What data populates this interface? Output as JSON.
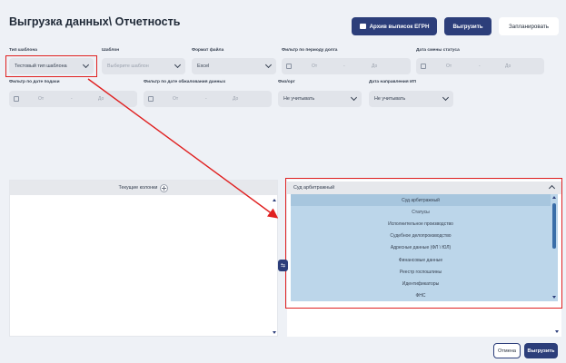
{
  "page": {
    "title": "Выгрузка данных\\ Отчетность"
  },
  "header_buttons": {
    "archive": "Архив выписок ЕГРН",
    "export": "Выгрузить",
    "schedule": "Запланировать"
  },
  "filters": {
    "template_type": {
      "label": "Тип шаблона",
      "value": "Тестовый тип шаблона"
    },
    "template": {
      "label": "Шаблон",
      "placeholder": "Выберите шаблон"
    },
    "file_format": {
      "label": "Формат файла",
      "value": "Excel"
    },
    "debt_period": {
      "label": "Фильтр по периоду долга",
      "from": "От",
      "dash": "-",
      "to": "До"
    },
    "status_change_date": {
      "label": "Дата смены статуса",
      "from": "От",
      "dash": "-",
      "to": "До"
    },
    "filing_date": {
      "label": "Фильтр по дате подачи",
      "from": "От",
      "dash": "-",
      "to": "До"
    },
    "appeal_date": {
      "label": "Фильтр по дате обжалования данных",
      "from": "От",
      "dash": "-",
      "to": "До"
    },
    "person_type": {
      "label": "Физ/орг",
      "value": "Не учитывать"
    },
    "ip_direction_date": {
      "label": "Дата направления ИП",
      "value": "Не учитывать"
    }
  },
  "columns_panel": {
    "header": "Текущие колонки"
  },
  "dropdown": {
    "header": "Суд арбитражный",
    "items": [
      "Суд арбитражный",
      "Статусы",
      "Исполнительное производство",
      "Судебное делопроизводство",
      "Адресные данные (ФЛ \\ ЮЛ)",
      "Финансовые данные",
      "Реестр госпошлины",
      "Идентификаторы",
      "ФНС"
    ],
    "selected_index": 0
  },
  "footer": {
    "cancel": "Отмена",
    "export": "Выгрузить"
  },
  "colors": {
    "accent": "#2c3e7a",
    "highlight": "#e02020",
    "list_bg": "#bcd6ea"
  }
}
